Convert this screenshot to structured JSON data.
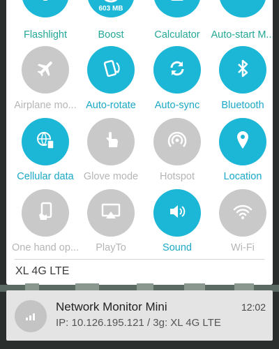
{
  "quick_settings": {
    "tiles": [
      {
        "label": "Flashlight",
        "icon": "flashlight-icon",
        "state": "on",
        "label_color": "teal"
      },
      {
        "label": "Boost",
        "icon": "boost-gauge-icon",
        "state": "on",
        "label_color": "teal",
        "badge": "603 MB"
      },
      {
        "label": "Calculator",
        "icon": "calculator-icon",
        "state": "on",
        "label_color": "teal"
      },
      {
        "label": "Auto-start M...",
        "icon": "auto-start-manager-icon",
        "state": "on",
        "label_color": "teal"
      },
      {
        "label": "Airplane mo...",
        "icon": "airplane-icon",
        "state": "off"
      },
      {
        "label": "Auto-rotate",
        "icon": "auto-rotate-icon",
        "state": "on"
      },
      {
        "label": "Auto-sync",
        "icon": "sync-icon",
        "state": "on"
      },
      {
        "label": "Bluetooth",
        "icon": "bluetooth-icon",
        "state": "on"
      },
      {
        "label": "Cellular data",
        "icon": "cellular-data-icon",
        "state": "on"
      },
      {
        "label": "Glove mode",
        "icon": "glove-touch-icon",
        "state": "off"
      },
      {
        "label": "Hotspot",
        "icon": "hotspot-icon",
        "state": "off"
      },
      {
        "label": "Location",
        "icon": "location-pin-icon",
        "state": "on"
      },
      {
        "label": "One hand op...",
        "icon": "one-hand-icon",
        "state": "off"
      },
      {
        "label": "PlayTo",
        "icon": "playto-icon",
        "state": "off"
      },
      {
        "label": "Sound",
        "icon": "speaker-icon",
        "state": "on"
      },
      {
        "label": "Wi-Fi",
        "icon": "wifi-icon",
        "state": "off"
      }
    ],
    "network_name": "XL 4G LTE"
  },
  "notification": {
    "title": "Network Monitor Mini",
    "text": "IP: 10.126.195.121 / 3g: XL 4G LTE",
    "time": "12:02",
    "icon": "signal-bars-icon"
  },
  "colors": {
    "active": "#1cb6d6",
    "inactive": "#c9c9c9",
    "teal_label": "#24a796",
    "active_label": "#1aa8c6",
    "inactive_label": "#b5b5b5"
  }
}
